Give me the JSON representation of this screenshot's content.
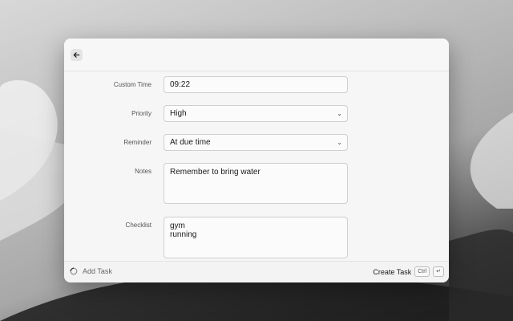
{
  "form": {
    "custom_time": {
      "label": "Custom Time",
      "value": "09:22"
    },
    "priority": {
      "label": "Priority",
      "value": "High"
    },
    "reminder": {
      "label": "Reminder",
      "value": "At due time"
    },
    "notes": {
      "label": "Notes",
      "value": "Remember to bring water"
    },
    "checklist": {
      "label": "Checklist",
      "items": [
        "gym",
        "running"
      ]
    }
  },
  "footer": {
    "add_task_label": "Add Task",
    "create_task_label": "Create Task",
    "shortcut_key_1": "Ctrl",
    "shortcut_key_2": "↵"
  },
  "icons": {
    "back": "arrow-left-icon",
    "add_task": "spinner-icon",
    "select": "chevron-down-icon"
  }
}
